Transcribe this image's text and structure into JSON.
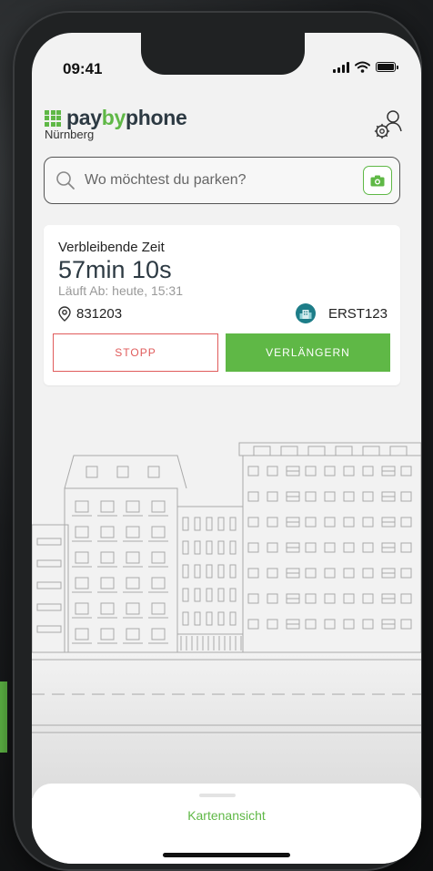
{
  "status_bar": {
    "time": "09:41"
  },
  "header": {
    "logo": {
      "part1": "pay",
      "part2": "by",
      "part3": "phone"
    },
    "city": "Nürnberg",
    "settings_icon": "account-settings-icon"
  },
  "search": {
    "placeholder": "Wo möchtest du parken?",
    "value": ""
  },
  "session": {
    "label": "Verbleibende Zeit",
    "remaining": "57min 10s",
    "expiry": "Läuft Ab: heute, 15:31",
    "zone": "831203",
    "plate": "ERST123",
    "stop_label": "STOPP",
    "extend_label": "VERLÄNGERN"
  },
  "bottom_sheet": {
    "map_link": "Kartenansicht"
  },
  "colors": {
    "accent": "#5fb846",
    "danger": "#e05c5c",
    "logo_dark": "#2d3a43",
    "background": "#f2f2f2"
  }
}
